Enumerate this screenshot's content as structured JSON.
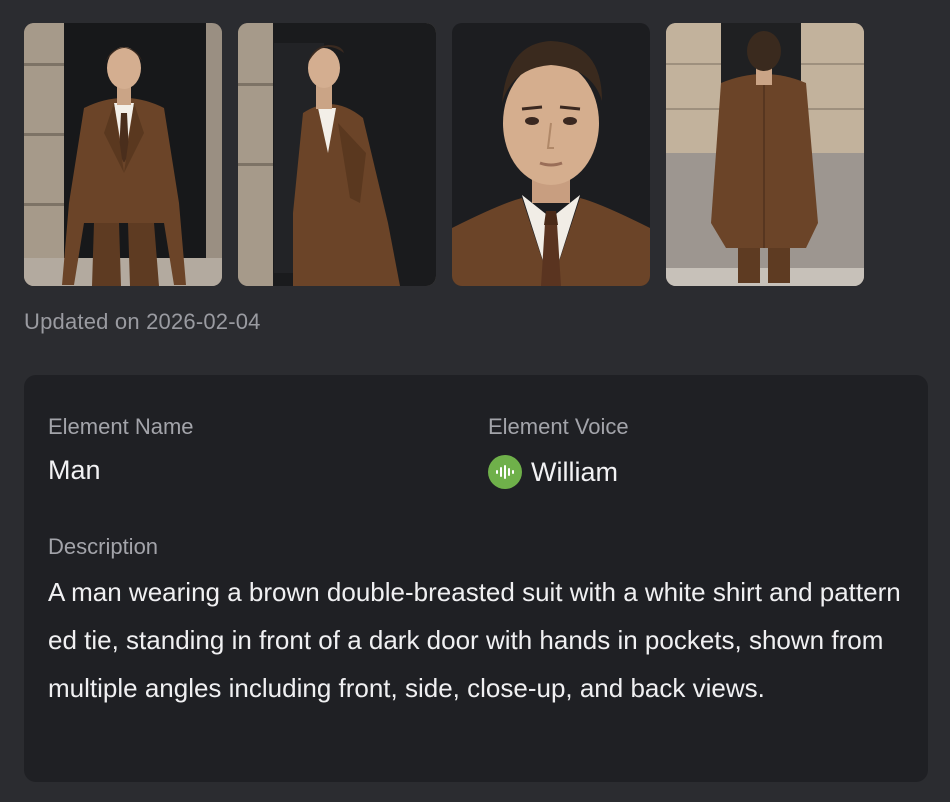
{
  "gallery": {
    "images": [
      {
        "icon": "man-front-view-image"
      },
      {
        "icon": "man-side-view-image"
      },
      {
        "icon": "man-closeup-image"
      },
      {
        "icon": "man-back-view-image"
      }
    ]
  },
  "updated_text": "Updated on 2026-02-04",
  "details": {
    "name_label": "Element Name",
    "name_value": "Man",
    "voice_label": "Element Voice",
    "voice_value": "William",
    "voice_icon": "soundwave-icon",
    "voice_icon_color": "#6fb04a",
    "description_label": "Description",
    "description_value": "A man wearing a brown double-breasted suit with a white shirt and patterned tie, standing in front of a dark door with hands in pockets, shown from multiple angles including front, side, close-up, and back views."
  },
  "colors": {
    "background": "#2b2c30",
    "card": "#1f2024",
    "suit_brown": "#6b4428"
  }
}
